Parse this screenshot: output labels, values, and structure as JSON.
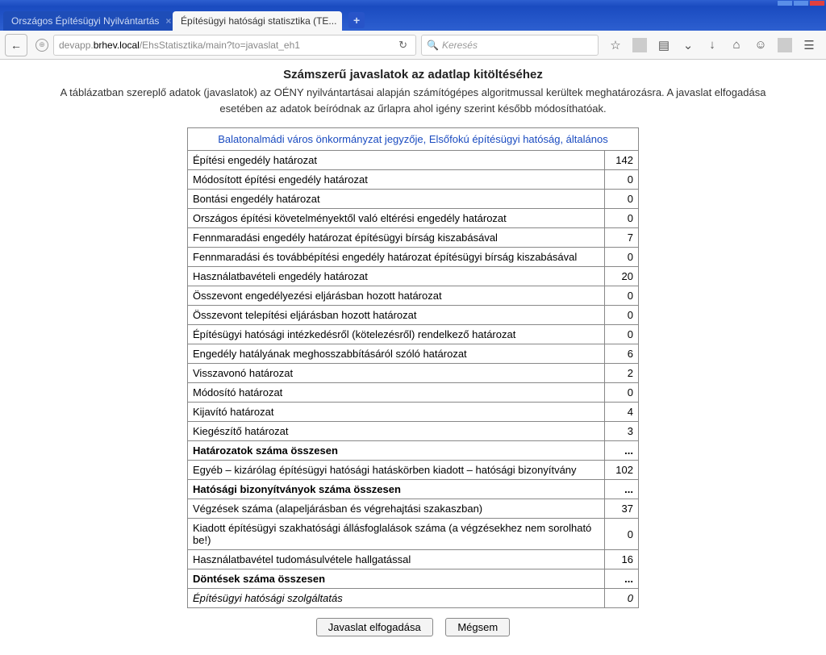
{
  "window": {
    "tabs": [
      {
        "label": "Országos Építésügyi Nyilvántartás",
        "active": false
      },
      {
        "label": "Építésügyi hatósági statisztika (TE...",
        "active": true
      }
    ]
  },
  "navbar": {
    "url_pre": "devapp.",
    "url_host": "brhev.local",
    "url_path": "/EhsStatisztika/main?to=javaslat_eh1",
    "search_placeholder": "Keresés"
  },
  "page": {
    "title": "Számszerű javaslatok az adatlap kitöltéséhez",
    "description": "A táblázatban szereplő adatok (javaslatok) az OÉNY nyilvántartásai alapján számítógépes algoritmussal kerültek meghatározásra. A javaslat elfogadása esetében az adatok beíródnak az űrlapra ahol igény szerint később módosíthatóak.",
    "header_link": "Balatonalmádi város önkormányzat jegyzője, Elsőfokú építésügyi hatóság, általános",
    "rows": [
      {
        "label": "Építési engedély határozat",
        "value": "142"
      },
      {
        "label": "Módosított építési engedély határozat",
        "value": "0"
      },
      {
        "label": "Bontási engedély határozat",
        "value": "0"
      },
      {
        "label": "Országos építési követelményektől való eltérési engedély határozat",
        "value": "0"
      },
      {
        "label": "Fennmaradási engedély határozat építésügyi bírság kiszabásával",
        "value": "7"
      },
      {
        "label": "Fennmaradási és továbbépítési engedély határozat építésügyi bírság kiszabásával",
        "value": "0"
      },
      {
        "label": "Használatbavételi engedély határozat",
        "value": "20"
      },
      {
        "label": "Összevont engedélyezési eljárásban hozott határozat",
        "value": "0"
      },
      {
        "label": "Összevont telepítési eljárásban hozott határozat",
        "value": "0"
      },
      {
        "label": "Építésügyi hatósági intézkedésről (kötelezésről) rendelkező határozat",
        "value": "0"
      },
      {
        "label": "Engedély hatályának meghosszabbításáról szóló határozat",
        "value": "6"
      },
      {
        "label": "Visszavonó határozat",
        "value": "2"
      },
      {
        "label": "Módosító határozat",
        "value": "0"
      },
      {
        "label": "Kijavító határozat",
        "value": "4"
      },
      {
        "label": "Kiegészítő határozat",
        "value": "3"
      },
      {
        "label": "Határozatok száma összesen",
        "value": "...",
        "bold": true
      },
      {
        "label": "Egyéb – kizárólag építésügyi hatósági hatáskörben kiadott – hatósági bizonyítvány",
        "value": "102"
      },
      {
        "label": "Hatósági bizonyítványok száma összesen",
        "value": "...",
        "bold": true
      },
      {
        "label": "Végzések száma (alapeljárásban és végrehajtási szakaszban)",
        "value": "37"
      },
      {
        "label": "Kiadott építésügyi szakhatósági állásfoglalások száma (a végzésekhez nem sorolható be!)",
        "value": "0"
      },
      {
        "label": "Használatbavétel tudomásulvétele hallgatással",
        "value": "16"
      },
      {
        "label": "Döntések száma összesen",
        "value": "...",
        "bold": true
      },
      {
        "label": "Építésügyi hatósági szolgáltatás",
        "value": "0",
        "italic": true
      }
    ],
    "accept_btn": "Javaslat elfogadása",
    "cancel_btn": "Mégsem"
  }
}
